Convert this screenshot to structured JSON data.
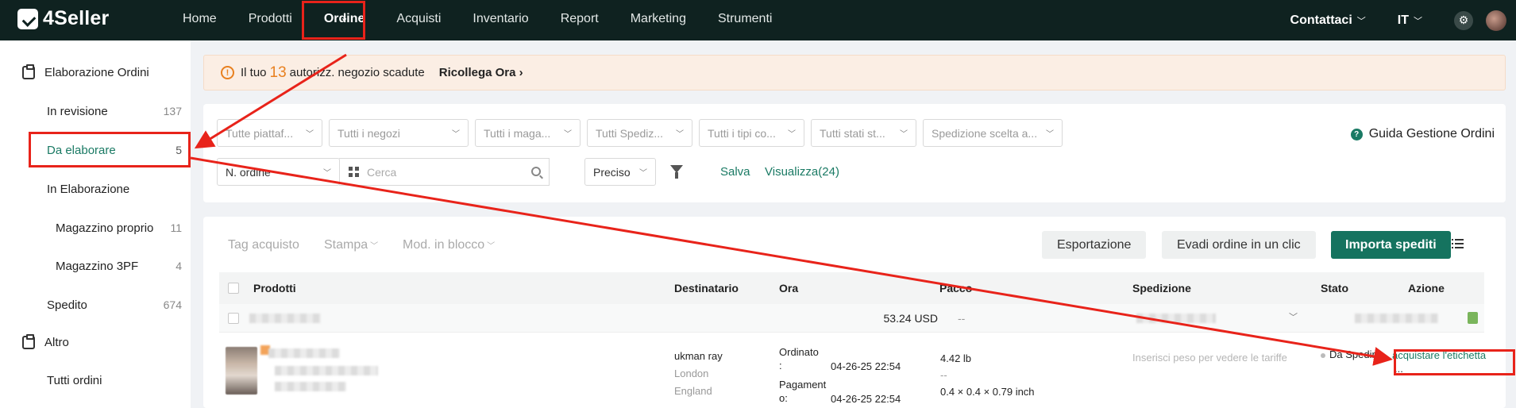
{
  "topbar": {
    "logo": "4Seller",
    "nav": [
      "Home",
      "Prodotti",
      "Ordine",
      "Acquisti",
      "Inventario",
      "Report",
      "Marketing",
      "Strumenti"
    ],
    "contact": "Contattaci",
    "language": "IT"
  },
  "sidebar": {
    "group1": "Elaborazione Ordini",
    "items": [
      {
        "label": "In revisione",
        "count": "137"
      },
      {
        "label": "Da elaborare",
        "count": "5"
      },
      {
        "label": "In Elaborazione",
        "count": ""
      },
      {
        "label": "Magazzino proprio",
        "count": "11"
      },
      {
        "label": "Magazzino 3PF",
        "count": "4"
      },
      {
        "label": "Spedito",
        "count": "674"
      }
    ],
    "group2": "Altro",
    "other_items": [
      {
        "label": "Tutti ordini"
      }
    ]
  },
  "alert": {
    "prefix": "Il tuo",
    "number": "13",
    "suffix": "autorizz. negozio scadute",
    "link": "Ricollega Ora"
  },
  "filters": {
    "selects": [
      "Tutte piattaf...",
      "Tutti i negozi",
      "Tutti i maga...",
      "Tutti Spediz...",
      "Tutti i tipi co...",
      "Tutti stati st...",
      "Spedizione scelta a..."
    ],
    "search_type": "N. ordine",
    "search_placeholder": "Cerca",
    "match": "Preciso",
    "save": "Salva",
    "view": "Visualizza(24)",
    "guide": "Guida Gestione Ordini"
  },
  "toolbar": {
    "tag": "Tag acquisto",
    "print": "Stampa",
    "bulk": "Mod. in blocco",
    "export": "Esportazione",
    "fulfill": "Evadi ordine in un clic",
    "import": "Importa spediti"
  },
  "table": {
    "headers": [
      "Prodotti",
      "Destinatario",
      "Ora",
      "Pacco",
      "Spedizione",
      "Stato",
      "Azione"
    ],
    "group_row": {
      "amount": "53.24 USD",
      "pacco": "--"
    },
    "row": {
      "name": "ukman ray",
      "city": "London",
      "country": "England",
      "ordered_label": "Ordinato\n:",
      "ordered_time": "04-26-25 22:54",
      "paid_label": "Pagament\no:",
      "paid_time": "04-26-25 22:54",
      "weight": "4.42 lb",
      "dash": "--",
      "dims": "0.4 × 0.4 × 0.79 inch",
      "shipping_hint": "Inserisci peso per vedere le tariffe",
      "status": "Da Spedire",
      "action": "acquistare l'etichetta",
      "more": "..."
    }
  },
  "colors": {
    "accent": "#1a7a64",
    "topbar": "#0f2220",
    "highlight": "#e8231a",
    "warning": "#e8801f"
  }
}
